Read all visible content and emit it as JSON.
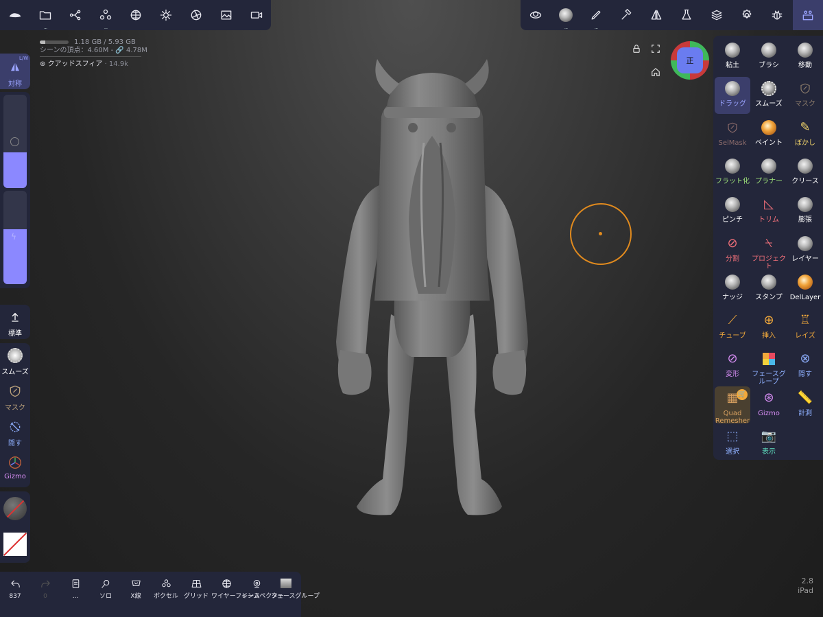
{
  "top_left_toolbar": {
    "icons": [
      "logo-icon",
      "folder-icon",
      "scene-graph-icon",
      "object-group-icon",
      "topology-sphere-icon",
      "sun-icon",
      "aperture-icon",
      "image-icon",
      "video-camera-icon"
    ]
  },
  "top_right_toolbar": {
    "icons": [
      "scene-objects-icon",
      "material-sphere-icon",
      "brush-pen-icon",
      "hammer-icon",
      "symmetry-icon",
      "flask-icon",
      "layers-icon",
      "settings-gear-icon",
      "bug-icon",
      "tool-panel-icon"
    ]
  },
  "stats": {
    "memory": "1.18 GB / 5.93 GB",
    "memory_fraction": 0.2,
    "vertices": "シーンの頂点：4.60M - 🔗 4.78M",
    "object_name": "クアッドスフィア",
    "object_count": "· 14.9k"
  },
  "viewport_controls": {
    "lock": "lock-icon",
    "fullscreen": "fullscreen-icon",
    "home": "home-icon",
    "gizmo_label": "正"
  },
  "left_panel": {
    "symmetry_label": "対称",
    "symmetry_badge": "L/W",
    "radius_slider_level": 0.38,
    "intensity_slider_level": 0.59,
    "standard_label": "標準",
    "quick_tools": [
      "スムーズ",
      "マスク",
      "隠す",
      "Gizmo"
    ]
  },
  "bottom_bar": {
    "undo_count": "837",
    "redo_count": "0",
    "items": [
      "...",
      "ソロ",
      "X線",
      "ボクセル",
      "グリッド",
      "ワイヤーフレーム",
      "インスペクター",
      "フェースグループ"
    ]
  },
  "tools": [
    {
      "label": "粘土",
      "color": "#ffffff"
    },
    {
      "label": "ブラシ",
      "color": "#ffffff"
    },
    {
      "label": "移動",
      "color": "#ffffff"
    },
    {
      "label": "ドラッグ",
      "color": "#9aa3ff"
    },
    {
      "label": "スムーズ",
      "color": "#ffffff"
    },
    {
      "label": "マスク",
      "color": "#8a7a6a"
    },
    {
      "label": "SelMask",
      "color": "#8a6a6a"
    },
    {
      "label": "ペイント",
      "color": "#ffffff"
    },
    {
      "label": "ぼかし",
      "color": "#f0d36a"
    },
    {
      "label": "フラット化",
      "color": "#9ee27a"
    },
    {
      "label": "プラナー",
      "color": "#9ee27a"
    },
    {
      "label": "クリース",
      "color": "#ffffff"
    },
    {
      "label": "ピンチ",
      "color": "#ffffff"
    },
    {
      "label": "トリム",
      "color": "#f2707a"
    },
    {
      "label": "膨張",
      "color": "#ffffff"
    },
    {
      "label": "分割",
      "color": "#f2707a"
    },
    {
      "label": "プロジェクト",
      "color": "#f2707a"
    },
    {
      "label": "レイヤー",
      "color": "#ffffff"
    },
    {
      "label": "ナッジ",
      "color": "#ffffff"
    },
    {
      "label": "スタンプ",
      "color": "#ffffff"
    },
    {
      "label": "DelLayer",
      "color": "#ffffff"
    },
    {
      "label": "チューブ",
      "color": "#f2a93b"
    },
    {
      "label": "挿入",
      "color": "#f2a93b"
    },
    {
      "label": "レイズ",
      "color": "#f2a93b"
    },
    {
      "label": "変形",
      "color": "#d58cf2"
    },
    {
      "label": "フェースグループ",
      "color": "#8fb0ff"
    },
    {
      "label": "隠す",
      "color": "#8fb0ff"
    },
    {
      "label": "Quad Remesher",
      "color": "#d8a060"
    },
    {
      "label": "Gizmo",
      "color": "#d58cf2"
    },
    {
      "label": "計測",
      "color": "#8fb0ff"
    },
    {
      "label": "選択",
      "color": "#8fb0ff"
    },
    {
      "label": "表示",
      "color": "#5fe0c0"
    }
  ],
  "version": {
    "number": "2.8",
    "device": "iPad"
  },
  "accent": "#8b88ff"
}
